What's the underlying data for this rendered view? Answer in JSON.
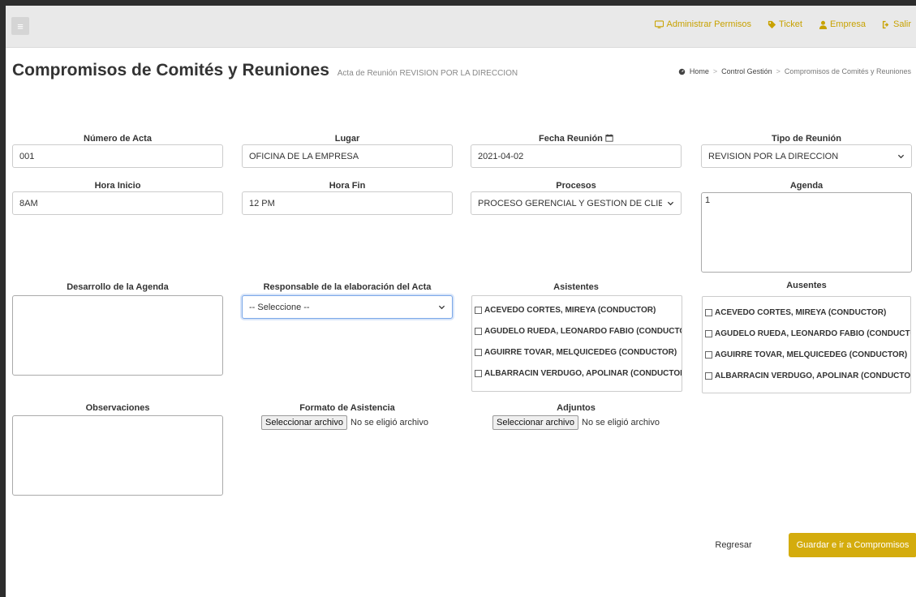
{
  "topbar": {
    "menu_glyph": "≡",
    "nav": [
      {
        "label": "Administrar Permisos",
        "icon": "monitor-icon"
      },
      {
        "label": "Ticket",
        "icon": "tag-icon"
      },
      {
        "label": "Empresa",
        "icon": "user-icon"
      },
      {
        "label": "Salir",
        "icon": "sign-out-icon"
      }
    ]
  },
  "header": {
    "title": "Compromisos de Comités y Reuniones",
    "subtitle": "Acta de Reunión REVISION POR LA DIRECCION",
    "breadcrumb": [
      "Home",
      "Control Gestión",
      "Compromisos de Comités y Reuniones"
    ]
  },
  "form": {
    "numero_acta": {
      "label": "Número de Acta",
      "value": "001"
    },
    "lugar": {
      "label": "Lugar",
      "value": "OFICINA DE LA EMPRESA"
    },
    "fecha_reunion": {
      "label": "Fecha Reunión",
      "value": "2021-04-02"
    },
    "tipo_reunion": {
      "label": "Tipo de Reunión",
      "value": "REVISION POR LA DIRECCION"
    },
    "hora_inicio": {
      "label": "Hora Inicio",
      "value": "8AM"
    },
    "hora_fin": {
      "label": "Hora Fin",
      "value": "12 PM"
    },
    "procesos": {
      "label": "Procesos",
      "value": "PROCESO GERENCIAL Y GESTION DE CLIEN"
    },
    "agenda": {
      "label": "Agenda",
      "value": "1"
    },
    "desarrollo_agenda": {
      "label": "Desarrollo de la Agenda",
      "value": ""
    },
    "responsable": {
      "label": "Responsable de la elaboración del Acta",
      "value": "-- Seleccione --"
    },
    "asistentes": {
      "label": "Asistentes",
      "items": [
        "ACEVEDO CORTES, MIREYA (CONDUCTOR)",
        "AGUDELO RUEDA, LEONARDO FABIO (CONDUCTOR)",
        "AGUIRRE TOVAR, MELQUICEDEG (CONDUCTOR)",
        "ALBARRACIN VERDUGO, APOLINAR (CONDUCTOR)"
      ]
    },
    "ausentes": {
      "label": "Ausentes",
      "items": [
        "ACEVEDO CORTES, MIREYA (CONDUCTOR)",
        "AGUDELO RUEDA, LEONARDO FABIO (CONDUCTOR)",
        "AGUIRRE TOVAR, MELQUICEDEG (CONDUCTOR)",
        "ALBARRACIN VERDUGO, APOLINAR (CONDUCTOR)"
      ]
    },
    "observaciones": {
      "label": "Observaciones",
      "value": ""
    },
    "formato_asistencia": {
      "label": "Formato de Asistencia",
      "button": "Seleccionar archivo",
      "status": "No se eligió archivo"
    },
    "adjuntos": {
      "label": "Adjuntos",
      "button": "Seleccionar archivo",
      "status": "No se eligió archivo"
    }
  },
  "actions": {
    "back_label": "Regresar",
    "save_label": "Guardar e ir a Compromisos"
  },
  "colors": {
    "accent": "#d4ac0d",
    "nav_link": "#c8a200",
    "focus": "#7aa7e8"
  }
}
